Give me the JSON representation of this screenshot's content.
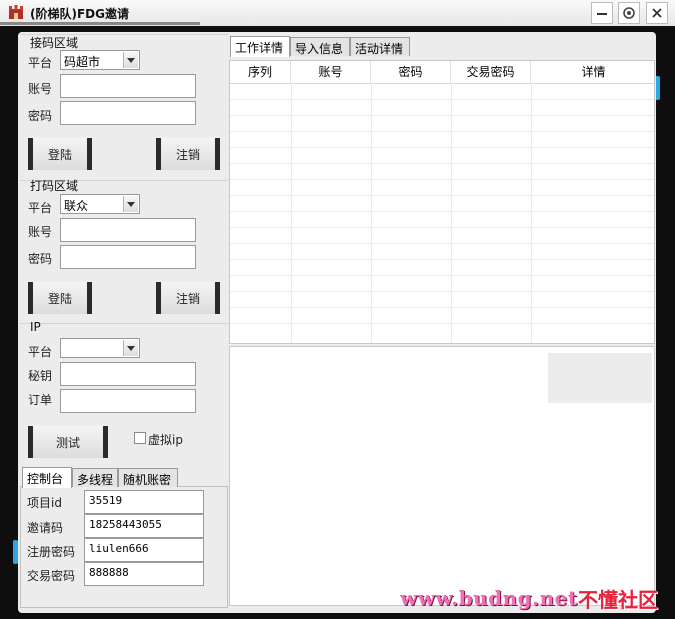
{
  "window": {
    "title": "(阶梯队)FDG邀请"
  },
  "colors": {
    "frame": "#0e0e0e",
    "panel": "#ececec",
    "accent": "#2aa8e8",
    "watermark_url": "#f070b8",
    "watermark_name": "#e8203c"
  },
  "icons": {
    "app": "castle-icon",
    "minimize": "minimize-icon",
    "settings": "gear-icon",
    "close": "close-icon",
    "dropdown": "chevron-down-icon"
  },
  "receive_group": {
    "title": "接码区域",
    "platform_label": "平台",
    "platform_value": "码超市",
    "account_label": "账号",
    "account_value": "",
    "password_label": "密码",
    "password_value": "",
    "login_label": "登陆",
    "logout_label": "注销"
  },
  "captcha_group": {
    "title": "打码区域",
    "platform_label": "平台",
    "platform_value": "联众",
    "account_label": "账号",
    "account_value": "",
    "password_label": "密码",
    "password_value": "",
    "login_label": "登陆",
    "logout_label": "注销"
  },
  "ip_group": {
    "title": "IP",
    "platform_label": "平台",
    "platform_value": "",
    "key_label": "秘钥",
    "key_value": "",
    "order_label": "订单",
    "order_value": "",
    "test_label": "测试",
    "virtual_ip_label": "虚拟ip",
    "virtual_ip_checked": false
  },
  "bottom_tabs": {
    "tabs": [
      "控制台",
      "多线程",
      "随机账密"
    ],
    "active": 0,
    "fields": [
      {
        "label": "项目id",
        "value": "35519"
      },
      {
        "label": "邀请码",
        "value": "18258443055"
      },
      {
        "label": "注册密码",
        "value": "liulen666"
      },
      {
        "label": "交易密码",
        "value": "888888"
      }
    ]
  },
  "main_tabs": {
    "tabs": [
      "工作详情",
      "导入信息",
      "活动详情"
    ],
    "active": 0
  },
  "grid": {
    "columns": [
      "序列",
      "账号",
      "密码",
      "交易密码",
      "详情"
    ],
    "rows": []
  },
  "watermark": {
    "url": "www.budng.net",
    "name": "不懂社区"
  }
}
